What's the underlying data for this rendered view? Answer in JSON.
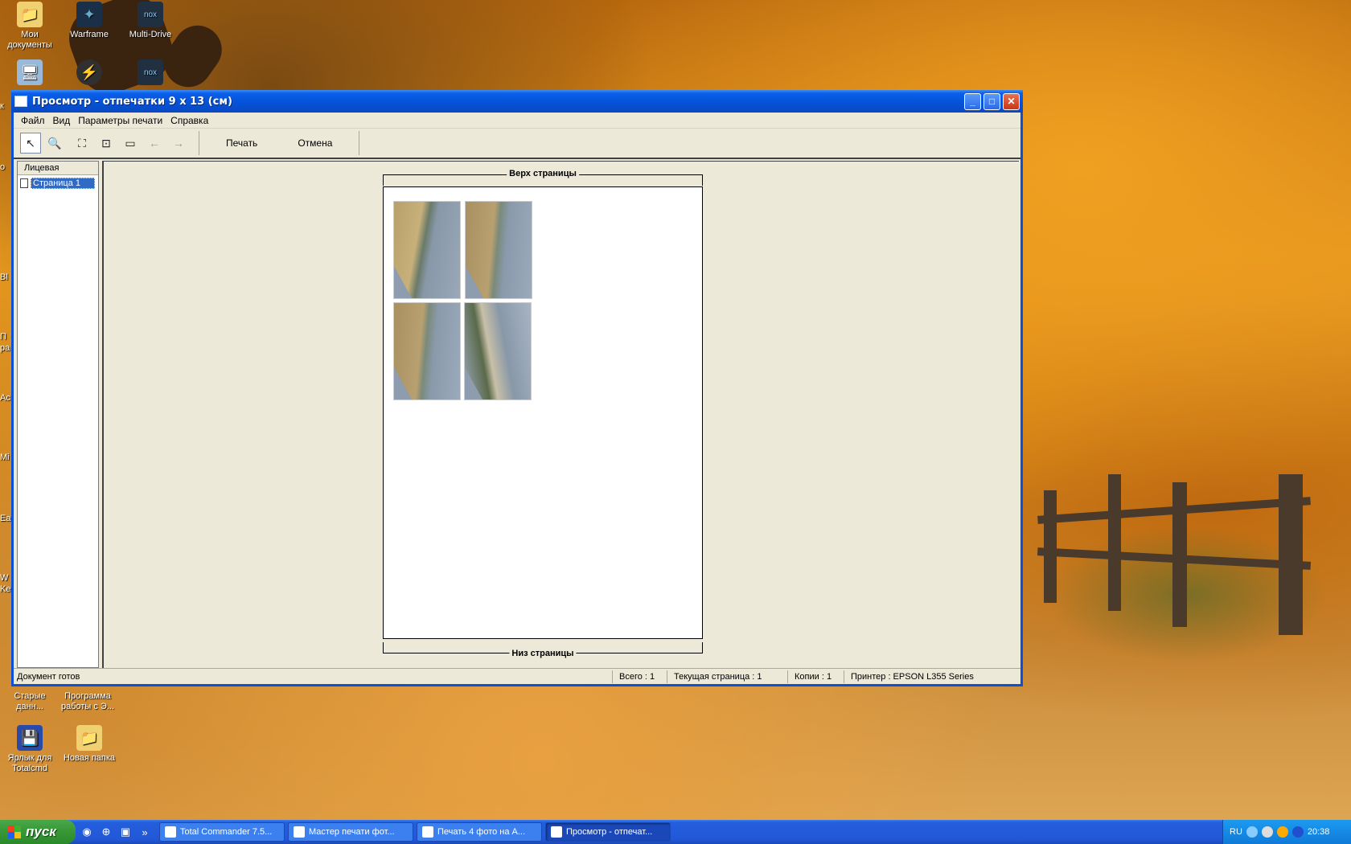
{
  "desktop": {
    "icons": [
      {
        "label": "Мои документы",
        "glyph": "folder-docs-icon"
      },
      {
        "label": "Warframe",
        "glyph": "warframe-icon"
      },
      {
        "label": "Multi-Drive",
        "glyph": "nox-icon"
      },
      {
        "label": "Старые данн...",
        "glyph": "folder-icon"
      },
      {
        "label": "Программа работы с Э...",
        "glyph": "program-icon"
      },
      {
        "label": "Ярлык для Totalcmd",
        "glyph": "floppy-icon"
      },
      {
        "label": "Новая папка",
        "glyph": "folder-icon"
      }
    ],
    "edge_labels": [
      "к",
      "о",
      "Bl",
      "П",
      "ра",
      "Ac",
      "Mi",
      "Ea",
      "W",
      "Ke"
    ]
  },
  "window": {
    "title": "Просмотр - отпечатки 9 x 13 (см)",
    "controls": {
      "minimize": "_",
      "maximize": "□",
      "close": "✕"
    },
    "menu": [
      "Файл",
      "Вид",
      "Параметры печати",
      "Справка"
    ],
    "toolbar": {
      "print_label": "Печать",
      "cancel_label": "Отмена"
    },
    "sidebar": {
      "header": "Лицевая",
      "items": [
        {
          "label": "Страница 1"
        }
      ]
    },
    "preview": {
      "top_label": "Верх страницы",
      "bottom_label": "Низ страницы",
      "photos_count": 4
    },
    "status": {
      "message": "Документ готов",
      "total": "Всего : 1",
      "current_page": "Текущая страница : 1",
      "copies": "Копии : 1",
      "printer": "Принтер : EPSON L355 Series"
    }
  },
  "taskbar": {
    "start_label": "пуск",
    "tasks": [
      {
        "label": "Total Commander 7.5...",
        "active": false
      },
      {
        "label": "Мастер печати фот...",
        "active": false
      },
      {
        "label": "Печать 4 фото на А...",
        "active": false
      },
      {
        "label": "Просмотр - отпечат...",
        "active": true
      }
    ],
    "tray": {
      "lang": "RU",
      "time": "20:38"
    }
  },
  "colors": {
    "xp_blue": "#0a5ee8",
    "selection": "#316ac5",
    "window_bg": "#ece9d8"
  }
}
